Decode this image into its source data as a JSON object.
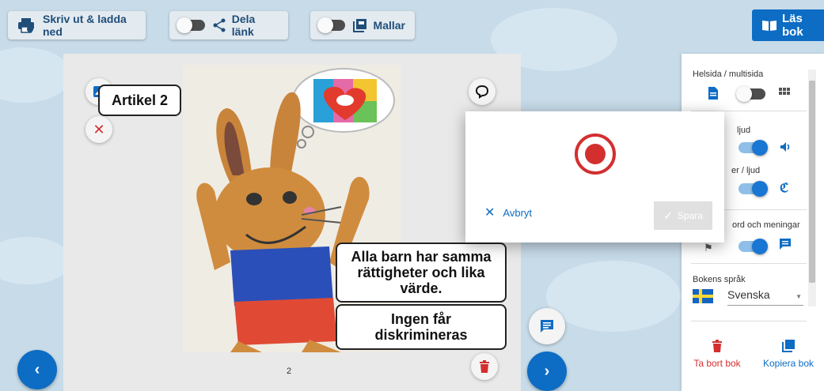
{
  "toolbar": {
    "print_label": "Skriv ut & ladda ned",
    "share_label": "Dela länk",
    "templates_label": "Mallar",
    "read_label": "Läs bok"
  },
  "page": {
    "title_box": "Artikel 2",
    "text_box_1": "Alla barn har samma rättigheter och lika värde.",
    "text_box_2": "Ingen får diskrimineras",
    "page_number": "2"
  },
  "panel": {
    "layout_label": "Helsida / multisida",
    "sound_label": "ljud",
    "other_sound_label": "er / ljud",
    "words_label": "ord och meningar",
    "language_label": "Bokens språk",
    "language_value": "Svenska",
    "delete_label": "Ta bort bok",
    "copy_label": "Kopiera bok"
  },
  "dialog": {
    "cancel_label": "Avbryt",
    "save_label": "Spara"
  },
  "colors": {
    "primary": "#0d6cc4",
    "danger": "#d32f2f",
    "background": "#c7dbe9"
  }
}
